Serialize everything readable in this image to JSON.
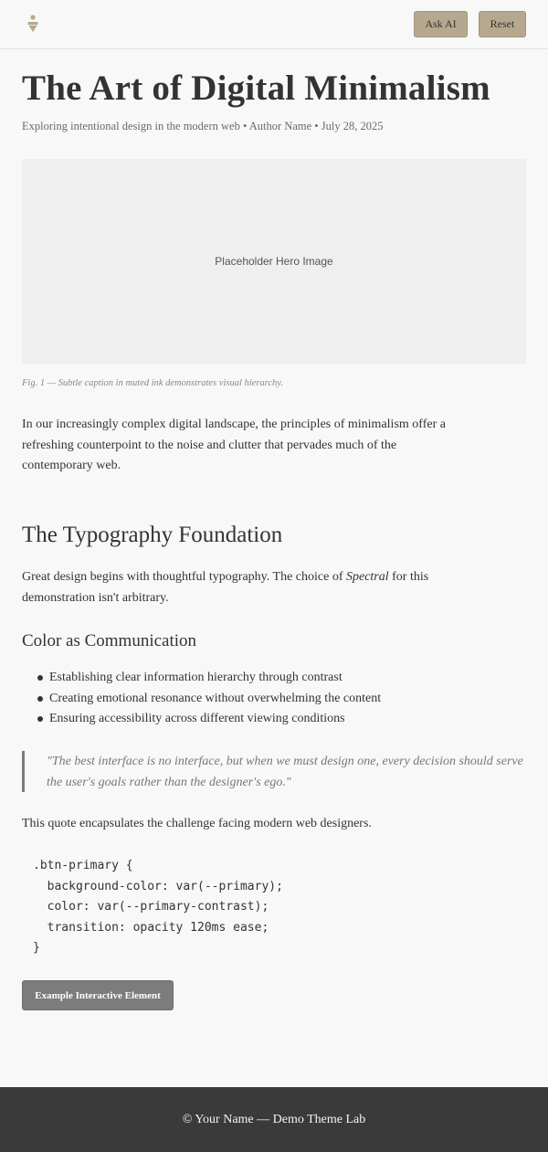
{
  "header": {
    "logo_icon": "person-glyph-icon",
    "ask_ai_label": "Ask AI",
    "reset_label": "Reset",
    "accent_color": "#b5a88e"
  },
  "article": {
    "title": "The Art of Digital Minimalism",
    "meta": "Exploring intentional design in the modern web • Author Name • July 28, 2025",
    "hero_placeholder": "Placeholder Hero Image",
    "caption": "Fig. 1 — Subtle caption in muted ink demonstrates visual hierarchy.",
    "intro": "In our increasingly complex digital landscape, the principles of minimalism offer a refreshing counterpoint to the noise and clutter that pervades much of the contemporary web.",
    "section1_heading": "The Typography Foundation",
    "section1_text_before": "Great design begins with thoughtful typography. The choice of ",
    "section1_text_em": "Spectral",
    "section1_text_after": " for this demonstration isn't arbitrary.",
    "section2_heading": "Color as Communication",
    "list_items": [
      "Establishing clear information hierarchy through contrast",
      "Creating emotional resonance without overwhelming the content",
      "Ensuring accessibility across different viewing conditions"
    ],
    "quote": "\"The best interface is no interface, but when we must design one, every decision should serve the user's goals rather than the designer's ego.\"",
    "after_quote": "This quote encapsulates the challenge facing modern web designers.",
    "code": ".btn-primary {\n  background-color: var(--primary);\n  color: var(--primary-contrast);\n  transition: opacity 120ms ease;\n}",
    "example_button_label": "Example Interactive Element"
  },
  "footer": {
    "text": "© Your Name — Demo Theme Lab"
  }
}
